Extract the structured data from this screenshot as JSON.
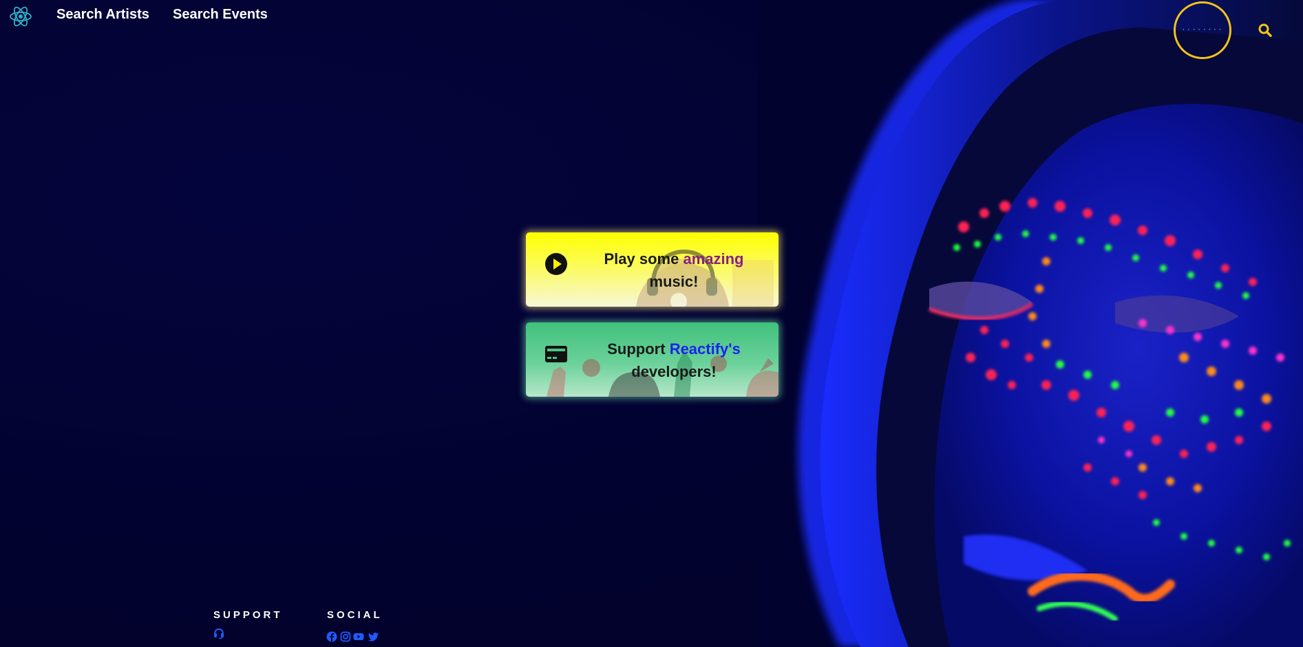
{
  "nav": {
    "logo_icon": "react-atom-icon",
    "links": [
      {
        "label": "Search Artists"
      },
      {
        "label": "Search Events"
      }
    ],
    "search": {
      "placeholder": "·········",
      "icon": "search-icon"
    }
  },
  "cards": {
    "play": {
      "icon": "play-circle-icon",
      "text_before": "Play some ",
      "highlight": "amazing",
      "text_after": " music!"
    },
    "support": {
      "icon": "credit-card-icon",
      "text_before": "Support ",
      "highlight": "Reactify's",
      "text_after": " developers!"
    }
  },
  "footer": {
    "support_heading": "SUPPORT",
    "social_heading": "SOCIAL",
    "support_icons": [
      "headset-icon"
    ],
    "social_icons": [
      "facebook-icon",
      "instagram-icon",
      "youtube-icon",
      "twitter-icon"
    ]
  },
  "colors": {
    "background": "#02022e",
    "accent_yellow": "#f2c318",
    "react_teal": "#2fb3c9",
    "social_blue": "#1f5bff",
    "amazing_purple": "#8a1f86",
    "reactify_blue": "#1a22f0"
  }
}
